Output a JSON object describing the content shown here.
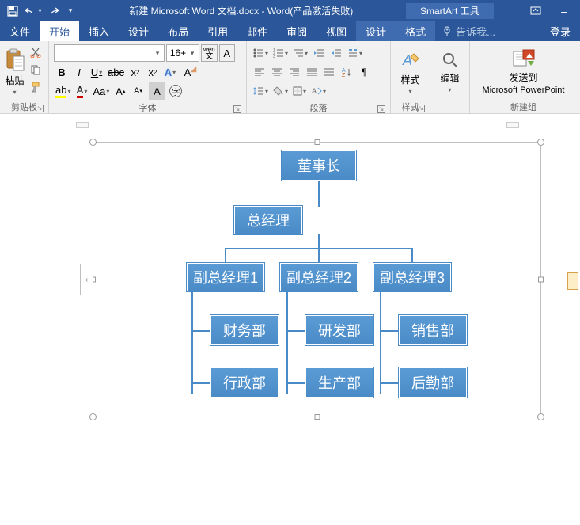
{
  "title": "新建 Microsoft Word 文档.docx - Word(产品激活失败)",
  "context_tool": "SmartArt 工具",
  "tabs": {
    "file": "文件",
    "home": "开始",
    "insert": "插入",
    "design": "设计",
    "layout": "布局",
    "references": "引用",
    "mailings": "邮件",
    "review": "审阅",
    "view": "视图",
    "sa_design": "设计",
    "sa_format": "格式"
  },
  "tellme": "告诉我...",
  "login": "登录",
  "ribbon": {
    "clipboard": {
      "label": "剪贴板",
      "paste": "粘贴"
    },
    "font": {
      "label": "字体",
      "size": "16+",
      "wen": "wén"
    },
    "paragraph": {
      "label": "段落"
    },
    "styles": {
      "label": "样式",
      "btn": "样式"
    },
    "editing": {
      "label": "",
      "btn": "编辑"
    },
    "newgroup": {
      "label": "新建组",
      "sendto": "发送到",
      "target": "Microsoft PowerPoint"
    }
  },
  "org": {
    "n1": "董事长",
    "n2": "总经理",
    "n3": "副总经理1",
    "n4": "副总经理2",
    "n5": "副总经理3",
    "n6": "财务部",
    "n7": "研发部",
    "n8": "销售部",
    "n9": "行政部",
    "n10": "生产部",
    "n11": "后勤部"
  }
}
